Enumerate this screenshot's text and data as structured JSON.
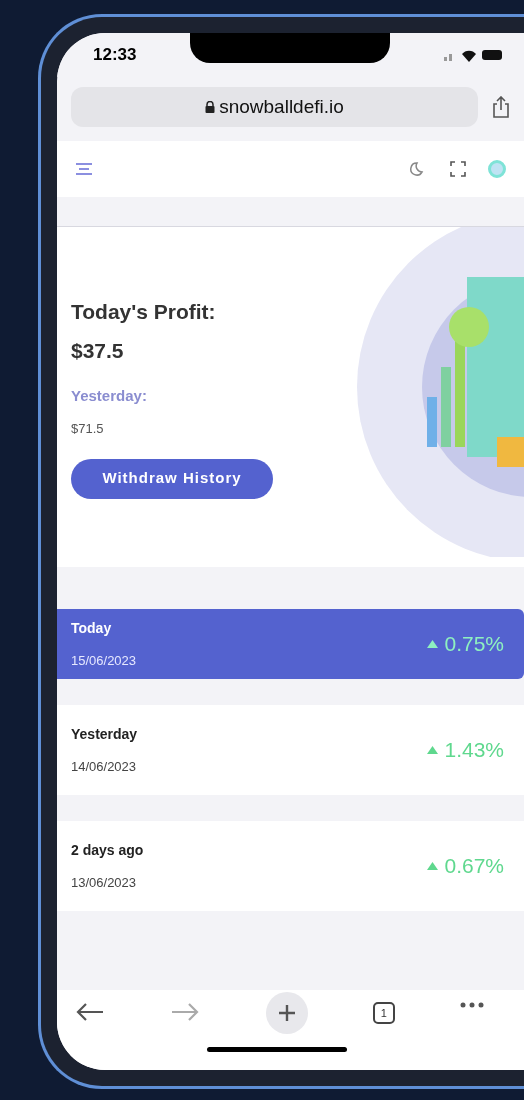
{
  "status_bar": {
    "time": "12:33"
  },
  "browser": {
    "url": "snowballdefi.io",
    "tab_count": "1"
  },
  "hero": {
    "title": "Today's Profit:",
    "amount": "$37.5",
    "yesterday_label": "Yesterday:",
    "yesterday_amount": "$71.5",
    "button": "Withdraw History"
  },
  "rows": [
    {
      "label": "Today",
      "date": "15/06/2023",
      "change": "0.75%",
      "selected": true
    },
    {
      "label": "Yesterday",
      "date": "14/06/2023",
      "change": "1.43%",
      "selected": false
    },
    {
      "label": "2 days ago",
      "date": "13/06/2023",
      "change": "0.67%",
      "selected": false
    }
  ]
}
